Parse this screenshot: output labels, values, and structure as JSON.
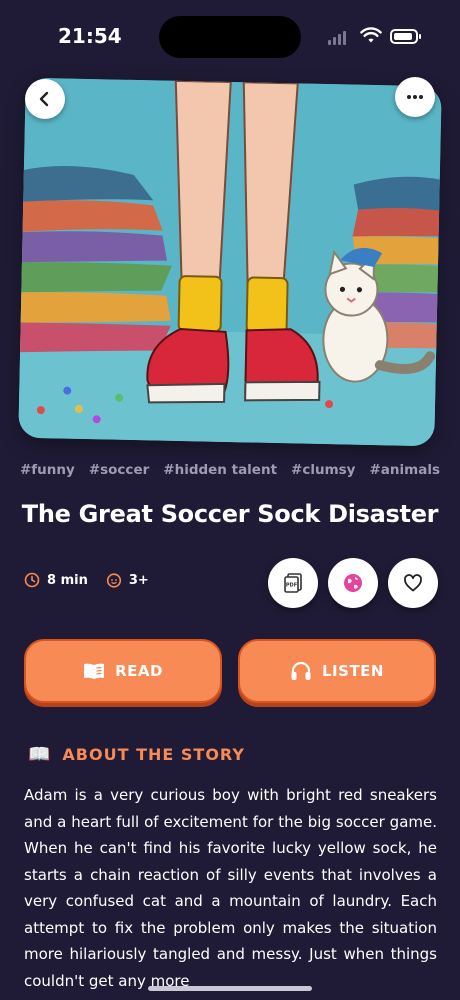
{
  "status_bar": {
    "time": "21:54"
  },
  "hero": {
    "image_alt": "Illustration of legs with yellow socks, red sneakers, a white cat and piles of laundry",
    "back_icon": "chevron-left-icon",
    "more_icon": "ellipsis-icon"
  },
  "tags": [
    "#funny",
    "#soccer",
    "#hidden talent",
    "#clumsy",
    "#animals"
  ],
  "title": "The Great Soccer Sock Disaster",
  "meta": {
    "duration": "8 min",
    "age": "3+",
    "duration_icon": "clock-icon",
    "age_icon": "child-face-icon"
  },
  "actions": {
    "pdf_icon": "pdf-icon",
    "globe_icon": "globe-icon",
    "heart_icon": "heart-icon"
  },
  "buttons": {
    "read_label": "READ",
    "listen_label": "LISTEN",
    "read_icon": "book-icon",
    "listen_icon": "headphones-icon"
  },
  "about": {
    "icon": "📖",
    "heading": "ABOUT THE STORY",
    "text": "Adam is a very curious boy with bright red sneakers and a heart full of excitement for the big soccer game. When he can't find his favorite lucky yellow sock, he starts a chain reaction of silly events that involves a very confused cat and a mountain of laundry. Each attempt to fix the problem only makes the situation more hilariously tangled and messy. Just when things couldn't get any more"
  },
  "colors": {
    "background": "#1f1b36",
    "accent": "#f78a55",
    "tag_text": "#9e9bb3",
    "globe": "#e0479c"
  }
}
